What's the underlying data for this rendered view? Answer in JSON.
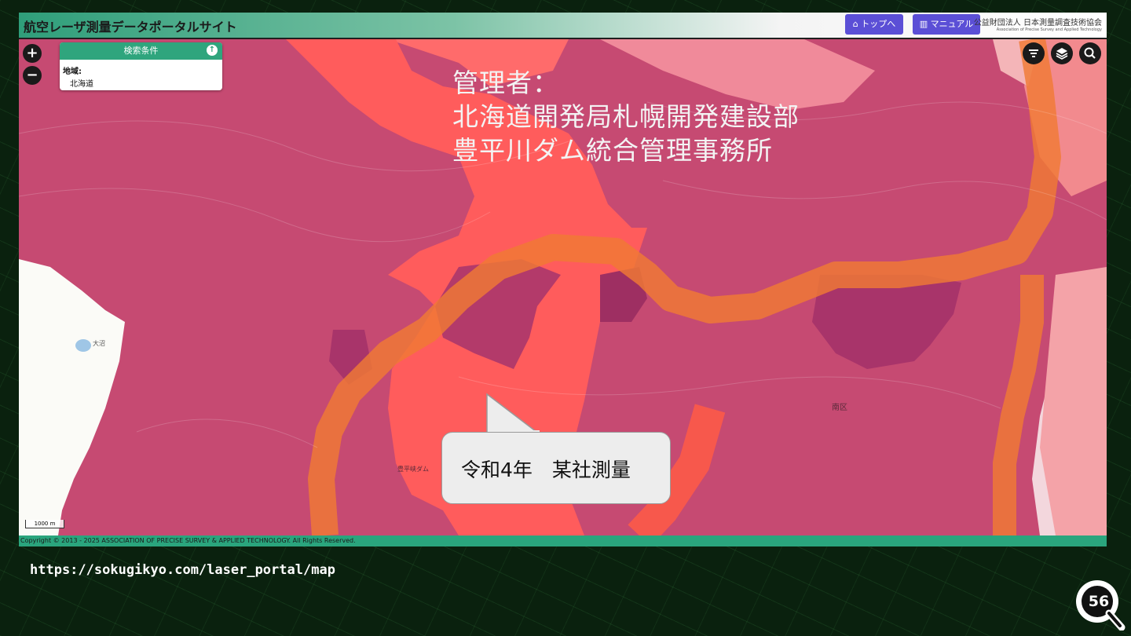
{
  "header": {
    "title": "航空レーザ測量データポータルサイト",
    "top_button": "トップへ",
    "manual_button": "マニュアル",
    "org_name": "公益財団法人 日本測量調査技術協会",
    "org_name_en": "Association of Precise Survey and Applied Technology"
  },
  "search_panel": {
    "title": "検索条件",
    "region_label": "地域:",
    "region_value": "北海道"
  },
  "map_controls": {
    "zoom_in": "+",
    "zoom_out": "−"
  },
  "overlay": {
    "line1": "管理者：",
    "line2": "北海道開発局札幌開発建設部",
    "line3": "豊平川ダム統合管理事務所"
  },
  "callout": {
    "text": "令和4年　某社測量"
  },
  "map_labels": {
    "ward": "南区",
    "dam": "豊平峡ダム",
    "lake": "大沼"
  },
  "scale_bar": "1000 m",
  "footer": {
    "copyright": "Copyright © 2013 - 2025 ASSOCIATION OF PRECISE SURVEY & APPLIED TECHNOLOGY. All Rights Reserved."
  },
  "slide": {
    "url": "https://sokugikyo.com/laser_portal/map",
    "page_number": "56"
  },
  "icons": [
    "home-icon",
    "book-icon",
    "arrow-up-icon",
    "filter-icon",
    "layers-icon",
    "search-icon",
    "magnifier-badge-icon"
  ],
  "colors": {
    "header_green": "#2f9e7a",
    "button_purple": "#5b4fd6",
    "coverage_magenta": "#c8466e",
    "coverage_red": "#ff5a5a",
    "route_orange": "#f07a35"
  }
}
